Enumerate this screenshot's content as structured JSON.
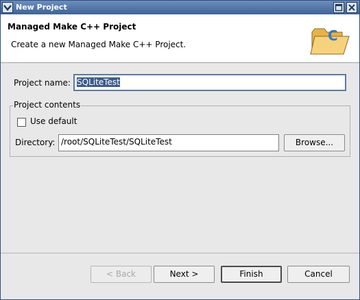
{
  "window": {
    "title": "New Project"
  },
  "banner": {
    "title": "Managed Make C++ Project",
    "description": "Create a new Managed Make C++ Project.",
    "icon": "folder-c-icon"
  },
  "form": {
    "project_name_label": "Project name:",
    "project_name_value": "SQLiteTest",
    "contents_group_title": "Project contents",
    "use_default_label": "Use default",
    "use_default_checked": false,
    "directory_label": "Directory:",
    "directory_value": "/root/SQLiteTest/SQLiteTest",
    "browse_label": "Browse..."
  },
  "footer": {
    "back_label": "< Back",
    "next_label": "Next >",
    "finish_label": "Finish",
    "cancel_label": "Cancel"
  }
}
